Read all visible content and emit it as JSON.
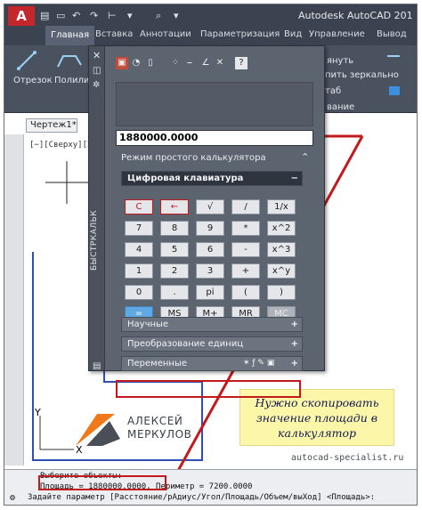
{
  "title_bar": {
    "app_button": "A",
    "title": "Autodesk AutoCAD 201"
  },
  "ribbon": {
    "tabs": [
      {
        "label": "Главная",
        "active": true
      },
      {
        "label": "Вставка"
      },
      {
        "label": "Аннотации"
      },
      {
        "label": "Параметризация"
      },
      {
        "label": "Вид"
      },
      {
        "label": "Управление"
      },
      {
        "label": "Вывод"
      }
    ],
    "tools": {
      "line": "Отрезок",
      "polyline": "Полилин",
      "stretch": "януть",
      "mirror": "пить зеркально",
      "scale": "таб",
      "panel_label": "вание"
    }
  },
  "drawing": {
    "document_tab": "Чертеж1*",
    "view_label": "[−][Сверху][2D",
    "ucs_y": "Y",
    "ucs_x": "X"
  },
  "calculator": {
    "vertical_title": "БЫСТРКАЛЬК",
    "display_value": "1880000.0000",
    "mode_label": "Режим простого калькулятора",
    "keypad_title": "Цифровая клавиатура",
    "keypad_toggle": "−",
    "keys": [
      [
        "C",
        "←",
        "√",
        "/",
        "1/x"
      ],
      [
        "7",
        "8",
        "9",
        "*",
        "x^2"
      ],
      [
        "4",
        "5",
        "6",
        "-",
        "x^3"
      ],
      [
        "1",
        "2",
        "3",
        "+",
        "x^y"
      ],
      [
        "0",
        ".",
        "pi",
        "(",
        ")"
      ],
      [
        "=",
        "MS",
        "M+",
        "MR",
        "MC"
      ]
    ],
    "sections": [
      {
        "label": "Научные",
        "toggle": "+"
      },
      {
        "label": "Преобразование единиц",
        "toggle": "+"
      },
      {
        "label": "Переменные",
        "toggle": "+"
      }
    ]
  },
  "command": {
    "line1": "Выберите объекты:",
    "line2_highlight": "Площадь = 1880000.0000,",
    "line2_rest": " Периметр = 7200.0000",
    "line3": "Задайте параметр [Расстояние/рАдиус/Угол/Площадь/Объем/выХод] <Площадь>:"
  },
  "note": {
    "lines": [
      "Нужно скопировать",
      "значение площади в",
      "калькулятор"
    ]
  },
  "watermark": {
    "logo_line1": "АЛЕКСЕЙ",
    "logo_line2": "МЕРКУЛОВ",
    "site": "autocad-specialist.ru"
  },
  "colors": {
    "highlight_red": "#c3191d",
    "app_red": "#c3272b",
    "logo_orange": "#f07a1a"
  }
}
